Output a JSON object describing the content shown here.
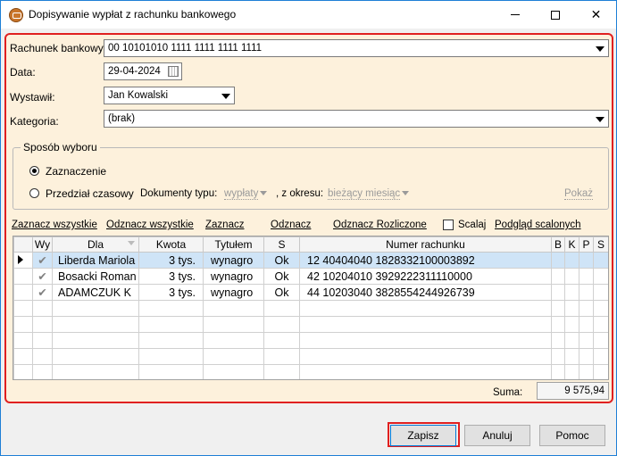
{
  "window": {
    "title": "Dopisywanie wypłat z rachunku bankowego",
    "minimize_icon": "minimize-icon",
    "maximize_icon": "maximize-icon",
    "close_glyph": "✕"
  },
  "form": {
    "bank_account_label": "Rachunek bankowy:",
    "bank_account_value": "00 10101010 1111 1111 1111 1111",
    "date_label": "Data:",
    "date_value": "29-04-2024",
    "issuer_label": "Wystawił:",
    "issuer_value": "Jan Kowalski",
    "category_label": "Kategoria:",
    "category_value": "(brak)"
  },
  "selection": {
    "group_title": "Sposób wyboru",
    "radio_selection_label": "Zaznaczenie",
    "radio_selection_checked": true,
    "radio_period_label": "Przedział czasowy",
    "radio_period_checked": false,
    "doc_type_label": "Dokumenty typu:",
    "doc_type_value": "wypłaty",
    "period_label": ", z okresu:",
    "period_value": "bieżący miesiąc",
    "show_label": "Pokaż"
  },
  "actions": {
    "select_all": "Zaznacz wszystkie",
    "deselect_all": "Odznacz wszystkie",
    "select": "Zaznacz",
    "deselect": "Odznacz",
    "deselect_settled": "Odznacz Rozliczone",
    "merge_label": "Scalaj",
    "merge_checked": false,
    "preview_merged": "Podgląd scalonych"
  },
  "table": {
    "columns": [
      "Wy",
      "Dla",
      "Kwota",
      "Tytułem",
      "S",
      "Numer rachunku",
      "B",
      "K",
      "P",
      "S"
    ],
    "rows": [
      {
        "selected": true,
        "checked": true,
        "dla": "Liberda Mariola",
        "kwota": "3 tys.",
        "tytulem": "wynagro",
        "s": "Ok",
        "numer": "12 40404040 1828332100003892"
      },
      {
        "selected": false,
        "checked": true,
        "dla": "Bosacki Roman",
        "kwota": "3 tys.",
        "tytulem": "wynagro",
        "s": "Ok",
        "numer": "42 10204010 3929222311110000"
      },
      {
        "selected": false,
        "checked": true,
        "dla": "ADAMCZUK K",
        "kwota": "3 tys.",
        "tytulem": "wynagro",
        "s": "Ok",
        "numer": "44 10203040 3828554244926739"
      }
    ],
    "check_glyph": "✔",
    "empty_rows": 5
  },
  "summary": {
    "label": "Suma:",
    "value": "9 575,94"
  },
  "buttons": {
    "save": "Zapisz",
    "cancel": "Anuluj",
    "help": "Pomoc"
  },
  "colors": {
    "highlight_border": "#e02020",
    "panel_bg": "#fdf1dc",
    "selected_row": "#cfe4f7"
  }
}
